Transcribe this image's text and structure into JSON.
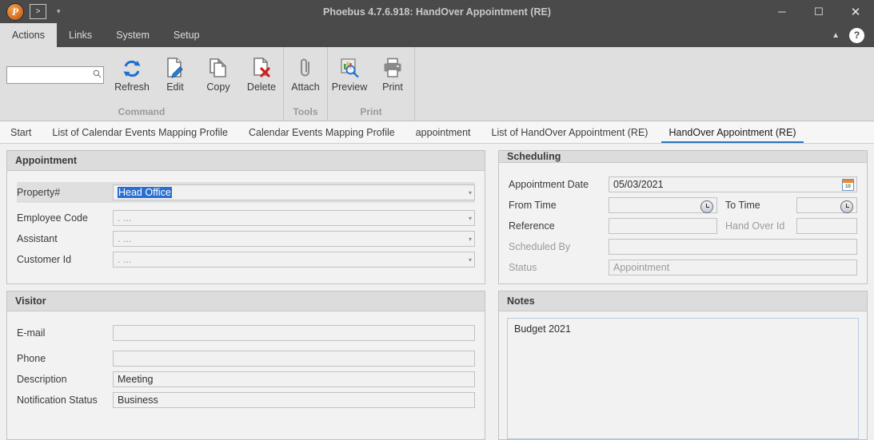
{
  "window": {
    "title": "Phoebus 4.7.6.918: HandOver Appointment (RE)",
    "app_logo_glyph": "P",
    "qat_button_glyph": ">",
    "qat_caret_glyph": "▾",
    "minimize_glyph": "─",
    "maximize_glyph": "☐",
    "close_glyph": "✕"
  },
  "menu": {
    "items": [
      {
        "label": "Actions",
        "active": true
      },
      {
        "label": "Links",
        "active": false
      },
      {
        "label": "System",
        "active": false
      },
      {
        "label": "Setup",
        "active": false
      }
    ],
    "collapse_glyph": "▲",
    "help_glyph": "?"
  },
  "ribbon": {
    "search": {
      "value": "",
      "placeholder": "",
      "icon": "search-icon",
      "icon_glyph": "⚲"
    },
    "groups": [
      {
        "label": "Command",
        "buttons": [
          {
            "label": "Refresh",
            "icon": "refresh-icon"
          },
          {
            "label": "Edit",
            "icon": "edit-pencil-icon"
          },
          {
            "label": "Copy",
            "icon": "copy-icon"
          },
          {
            "label": "Delete",
            "icon": "delete-icon"
          }
        ]
      },
      {
        "label": "Tools",
        "buttons": [
          {
            "label": "Attach",
            "icon": "paperclip-icon"
          }
        ]
      },
      {
        "label": "Print",
        "buttons": [
          {
            "label": "Preview",
            "icon": "print-preview-icon"
          },
          {
            "label": "Print",
            "icon": "printer-icon"
          }
        ]
      }
    ]
  },
  "tabs": {
    "accent_color": "#2a74c4",
    "items": [
      {
        "label": "Start",
        "active": false
      },
      {
        "label": "List of Calendar Events Mapping Profile",
        "active": false
      },
      {
        "label": "Calendar Events Mapping Profile",
        "active": false
      },
      {
        "label": "appointment",
        "active": false
      },
      {
        "label": "List of HandOver Appointment (RE)",
        "active": false
      },
      {
        "label": "HandOver Appointment (RE)",
        "active": true
      }
    ]
  },
  "panels": {
    "appointment": {
      "title": "Appointment",
      "fields": [
        {
          "label": "Property#",
          "value": "Head Office",
          "selected": true,
          "type": "combo",
          "highlight": true
        },
        {
          "label": "Employee Code",
          "value": ". ...",
          "selected": false,
          "type": "combo",
          "highlight": false
        },
        {
          "label": "Assistant",
          "value": ". ...",
          "selected": false,
          "type": "combo",
          "highlight": false
        },
        {
          "label": "Customer Id",
          "value": ". ...",
          "selected": false,
          "type": "combo",
          "highlight": false
        }
      ],
      "dropdown_glyph": "▾"
    },
    "scheduling": {
      "title": "Scheduling",
      "appointment_date_label": "Appointment Date",
      "appointment_date_value": "05/03/2021",
      "calendar_icon_day": "10",
      "from_time_label": "From Time",
      "from_time_value": "",
      "to_time_label": "To Time",
      "to_time_value": "",
      "reference_label": "Reference",
      "reference_value": "",
      "hand_over_id_label": "Hand Over Id",
      "hand_over_id_value": "",
      "scheduled_by_label": "Scheduled By",
      "scheduled_by_value": "",
      "status_label": "Status",
      "status_value": "Appointment"
    },
    "visitor": {
      "title": "Visitor",
      "fields": [
        {
          "label": "E-mail",
          "value": ""
        },
        {
          "label": "Phone",
          "value": ""
        },
        {
          "label": "Description",
          "value": "Meeting"
        },
        {
          "label": "Notification Status",
          "value": "Business"
        }
      ]
    },
    "notes": {
      "title": "Notes",
      "text": "Budget 2021"
    }
  }
}
